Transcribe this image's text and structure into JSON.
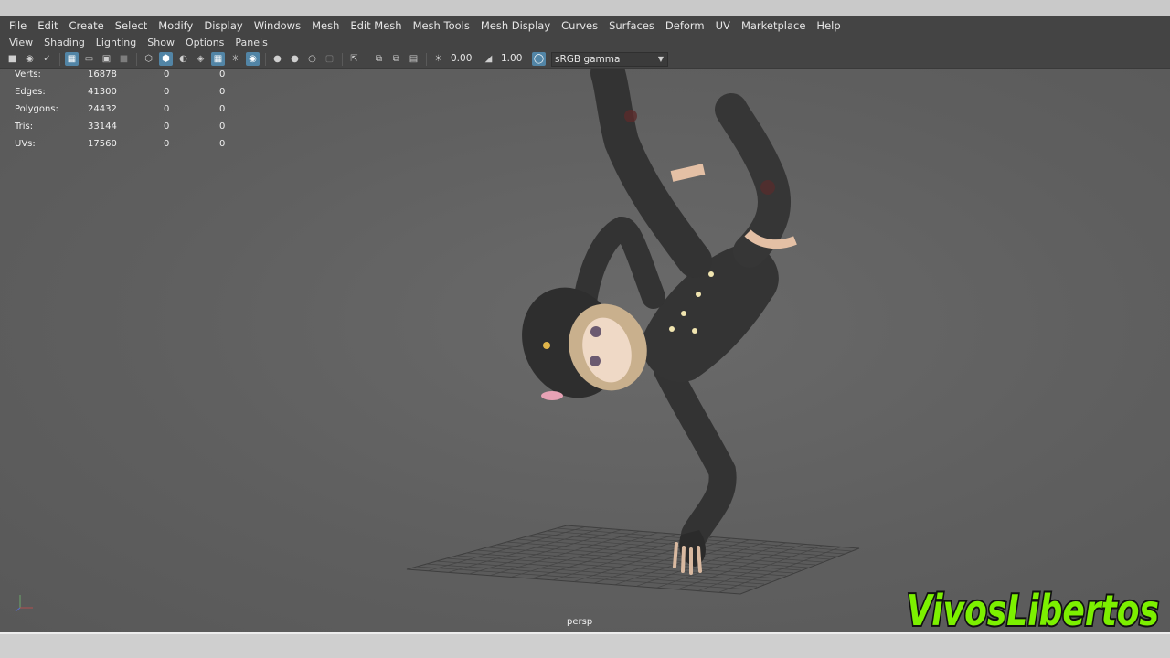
{
  "menubar": [
    "File",
    "Edit",
    "Create",
    "Select",
    "Modify",
    "Display",
    "Windows",
    "Mesh",
    "Edit Mesh",
    "Mesh Tools",
    "Mesh Display",
    "Curves",
    "Surfaces",
    "Deform",
    "UV",
    "Marketplace",
    "Help"
  ],
  "panel_menu": [
    "View",
    "Shading",
    "Lighting",
    "Show",
    "Options",
    "Panels"
  ],
  "toolbar": {
    "exposure_value": "0.00",
    "gamma_value": "1.00",
    "color_space": "sRGB gamma"
  },
  "hud": {
    "rows": [
      {
        "label": "Verts:",
        "v1": "16878",
        "v2": "0",
        "v3": "0"
      },
      {
        "label": "Edges:",
        "v1": "41300",
        "v2": "0",
        "v3": "0"
      },
      {
        "label": "Polygons:",
        "v1": "24432",
        "v2": "0",
        "v3": "0"
      },
      {
        "label": "Tris:",
        "v1": "33144",
        "v2": "0",
        "v3": "0"
      },
      {
        "label": "UVs:",
        "v1": "17560",
        "v2": "0",
        "v3": "0"
      }
    ]
  },
  "viewport": {
    "camera_label": "persp"
  },
  "watermark": {
    "text": "VivosLibertos",
    "color": "#7cf000"
  }
}
